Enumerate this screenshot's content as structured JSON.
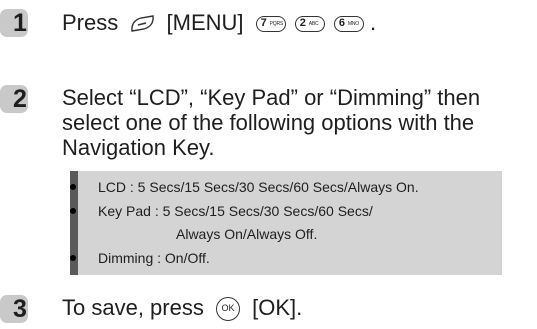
{
  "steps": [
    {
      "number": "1",
      "text_a": "Press",
      "menu_label": "[MENU]",
      "keys": [
        {
          "digit": "7",
          "letters": "PQRS"
        },
        {
          "digit": "2",
          "letters": "ABC"
        },
        {
          "digit": "6",
          "letters": "MNO"
        }
      ],
      "end": "."
    },
    {
      "number": "2",
      "line1": "Select “LCD”, “Key Pad” or “Dimming” then",
      "line2": "select one of the following options with the",
      "line3": "Navigation Key."
    },
    {
      "number": "3",
      "text_a": "To save, press",
      "ok_key": "OK",
      "ok_label": "[OK]."
    }
  ],
  "options": [
    "LCD : 5 Secs/15 Secs/30 Secs/60 Secs/Always On.",
    "Key Pad : 5 Secs/15 Secs/30 Secs/60 Secs/",
    "Always On/Always Off.",
    "Dimming : On/Off."
  ]
}
